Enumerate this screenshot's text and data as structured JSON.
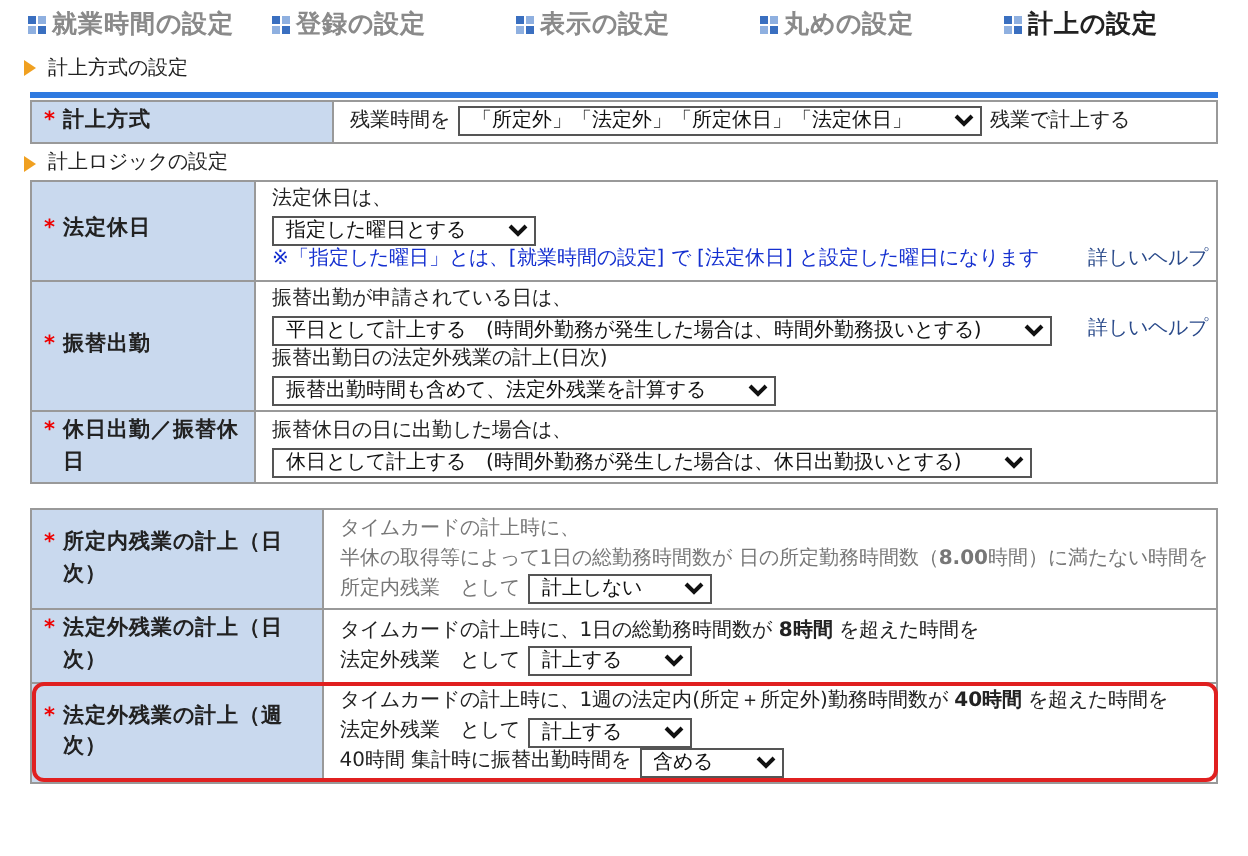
{
  "tabs": [
    {
      "label": "就業時間の設定",
      "selected": false
    },
    {
      "label": "登録の設定",
      "selected": false
    },
    {
      "label": "表示の設定",
      "selected": false
    },
    {
      "label": "丸めの設定",
      "selected": false
    },
    {
      "label": "計上の設定",
      "selected": true
    }
  ],
  "sections": [
    {
      "heading": "計上方式の設定",
      "rule": true,
      "rows": [
        {
          "mark": "*",
          "label": "計上方式",
          "disabled": false,
          "highlighted": false,
          "lines": [
            [
              {
                "kind": "text",
                "text": "残業時間を"
              },
              {
                "kind": "select",
                "value": "「所定外」「法定外」「所定休日」「法定休日」"
              },
              {
                "kind": "text",
                "text": "残業で計上する"
              }
            ]
          ]
        }
      ]
    },
    {
      "heading": "計上ロジックの設定",
      "rule": false,
      "rows": [
        {
          "mark": "*",
          "label": "法定休日",
          "disabled": false,
          "highlighted": false,
          "lines": [
            [
              {
                "kind": "text",
                "text": "法定休日は、"
              }
            ],
            [
              {
                "kind": "select",
                "value": "指定した曜日とする"
              }
            ],
            [
              {
                "kind": "note",
                "text": "※「指定した曜日」とは、[就業時間の設定] で [法定休日] と設定した曜日になります"
              },
              {
                "kind": "help",
                "text": "詳しいヘルプ"
              }
            ]
          ]
        },
        {
          "mark": "*",
          "label": "振替出勤",
          "disabled": false,
          "highlighted": false,
          "lines": [
            [
              {
                "kind": "text",
                "text": "振替出勤が申請されている日は、"
              }
            ],
            [
              {
                "kind": "select",
                "value": "平日として計上する　(時間外勤務が発生した場合は、時間外勤務扱いとする)"
              },
              {
                "kind": "help",
                "text": "詳しいヘルプ"
              }
            ],
            [
              {
                "kind": "text",
                "text": "振替出勤日の法定外残業の計上(日次)"
              }
            ],
            [
              {
                "kind": "select",
                "value": "振替出勤時間も含めて、法定外残業を計算する"
              }
            ]
          ]
        },
        {
          "mark": "*",
          "label": "休日出勤／振替休日",
          "disabled": false,
          "highlighted": false,
          "lines": [
            [
              {
                "kind": "text",
                "text": "振替休日の日に出勤した場合は、"
              }
            ],
            [
              {
                "kind": "select",
                "value": "休日として計上する　(時間外勤務が発生した場合は、休日出勤扱いとする)"
              }
            ]
          ]
        }
      ]
    },
    {
      "rows": [
        {
          "mark": "*",
          "label": "所定内残業の計上（日次）",
          "disabled": true,
          "highlighted": false,
          "lines": [
            [
              {
                "kind": "text",
                "text": "タイムカードの計上時に、"
              }
            ],
            [
              {
                "kind": "text",
                "text": "半休の取得等によって1日の総勤務時間数が 日の所定勤務時間数（**8.00**時間）に満たない時間を"
              }
            ],
            [
              {
                "kind": "text",
                "text": "所定内残業　として"
              },
              {
                "kind": "select",
                "value": "計上しない"
              }
            ]
          ]
        },
        {
          "mark": "*",
          "label": "法定外残業の計上（日次）",
          "disabled": false,
          "highlighted": false,
          "lines": [
            [
              {
                "kind": "text",
                "text": "タイムカードの計上時に、1日の総勤務時間数が **8時間** を超えた時間を"
              }
            ],
            [
              {
                "kind": "text",
                "text": "法定外残業　として"
              },
              {
                "kind": "select",
                "value": "計上する"
              }
            ]
          ]
        },
        {
          "mark": "*",
          "label": "法定外残業の計上（週次）",
          "disabled": false,
          "highlighted": true,
          "lines": [
            [
              {
                "kind": "text",
                "text": "タイムカードの計上時に、1週の法定内(所定＋所定外)勤務時間数が **40時間** を超えた時間を"
              }
            ],
            [
              {
                "kind": "text",
                "text": "法定外残業　として"
              },
              {
                "kind": "select",
                "value": "計上する"
              }
            ],
            [
              {
                "kind": "text",
                "text": "40時間 集計時に振替出勤時間を"
              },
              {
                "kind": "select",
                "value": "含める"
              }
            ]
          ]
        }
      ]
    }
  ]
}
